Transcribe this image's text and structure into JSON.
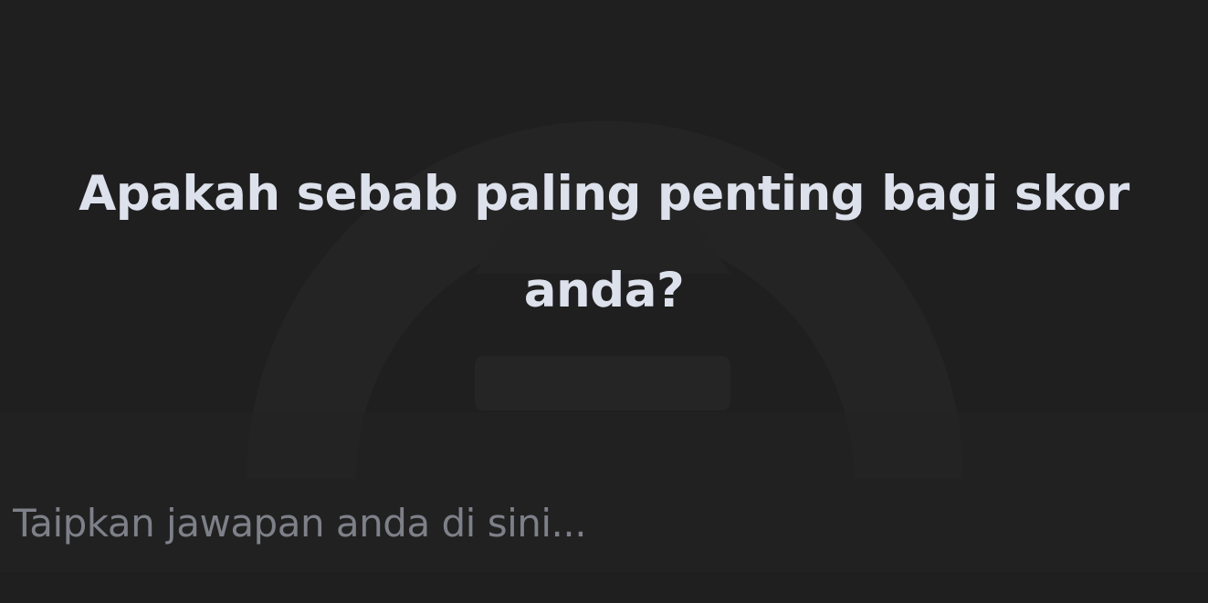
{
  "prompt": {
    "question": "Apakah sebab paling penting bagi skor anda?"
  },
  "answer": {
    "placeholder": "Taipkan jawapan anda di sini...",
    "value": ""
  },
  "theme": {
    "background": "#1f1f1f",
    "text": "#dde1ec",
    "placeholder": "#7e8089"
  },
  "background_icon": "faint-speedometer-gauge-icon"
}
